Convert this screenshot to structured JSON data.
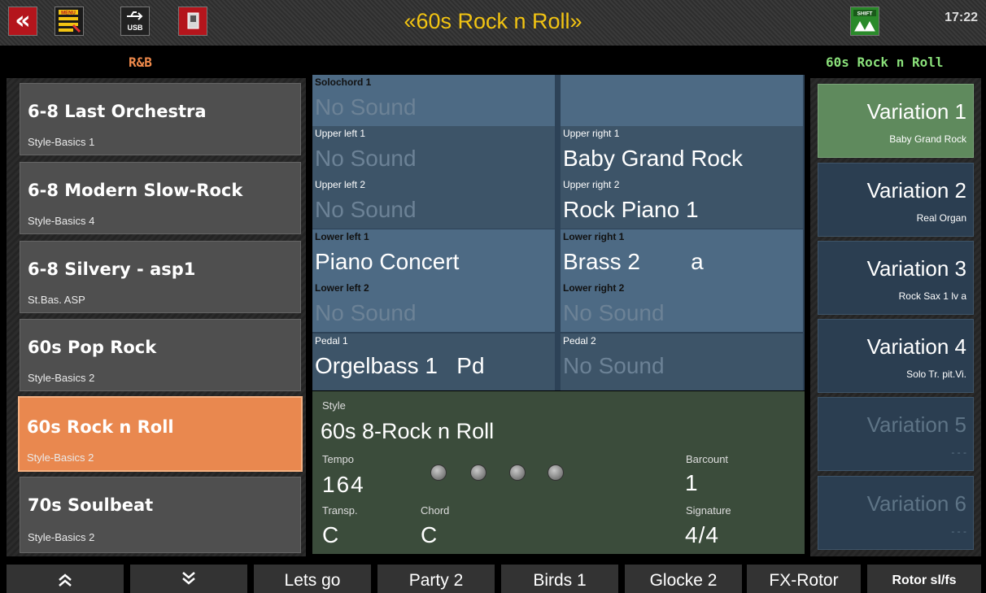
{
  "title": "«60s Rock n Roll»",
  "clock": "17:22",
  "toolbar": {
    "back_icon": "«",
    "menu_label": "MENU",
    "usb_label": "USB",
    "shift_label": "SHIFT"
  },
  "category": "R&B",
  "current_style_header": "60s Rock n Roll",
  "styles": [
    {
      "name": "6-8 Last Orchestra",
      "sub": "Style-Basics 1"
    },
    {
      "name": "6-8 Modern Slow-Rock",
      "sub": "Style-Basics 4"
    },
    {
      "name": "6-8 Silvery - asp1",
      "sub": "St.Bas. ASP"
    },
    {
      "name": "60s Pop Rock",
      "sub": "Style-Basics 2"
    },
    {
      "name": "60s Rock n Roll",
      "sub": "Style-Basics 2"
    },
    {
      "name": "70s Soulbeat",
      "sub": "Style-Basics 2"
    }
  ],
  "sounds": {
    "solochord1": {
      "label": "Solochord 1",
      "value": "No Sound"
    },
    "upper_left1": {
      "label": "Upper left 1",
      "value": "No Sound"
    },
    "upper_right1": {
      "label": "Upper right 1",
      "value": "Baby Grand Rock"
    },
    "upper_left2": {
      "label": "Upper left 2",
      "value": "No Sound"
    },
    "upper_right2": {
      "label": "Upper right 2",
      "value": "Rock Piano 1"
    },
    "lower_left1": {
      "label": "Lower left 1",
      "value": "Piano Concert"
    },
    "lower_right1": {
      "label": "Lower right 1",
      "value": "Brass 2        a"
    },
    "lower_left2": {
      "label": "Lower left 2",
      "value": "No Sound"
    },
    "lower_right2": {
      "label": "Lower right 2",
      "value": "No Sound"
    },
    "pedal1": {
      "label": "Pedal 1",
      "value": "Orgelbass 1   Pd"
    },
    "pedal2": {
      "label": "Pedal 2",
      "value": "No Sound"
    }
  },
  "style_info": {
    "style_label": "Style",
    "style_value": "60s 8-Rock n Roll",
    "tempo_label": "Tempo",
    "tempo_value": "164",
    "barcount_label": "Barcount",
    "barcount_value": "1",
    "transp_label": "Transp.",
    "transp_value": "C",
    "chord_label": "Chord",
    "chord_value": "C",
    "signature_label": "Signature",
    "signature_value": "4/4"
  },
  "variations": [
    {
      "title": "Variation 1",
      "sub": "Baby Grand Rock"
    },
    {
      "title": "Variation 2",
      "sub": "Real Organ"
    },
    {
      "title": "Variation 3",
      "sub": "Rock Sax 1 lv  a"
    },
    {
      "title": "Variation 4",
      "sub": "Solo Tr. pit.Vi."
    },
    {
      "title": "Variation 5",
      "sub": "- - -"
    },
    {
      "title": "Variation 6",
      "sub": "- - -"
    }
  ],
  "bottom": {
    "up": "≈",
    "down": "≈",
    "b1": "Lets go",
    "b2": "Party 2",
    "b3": "Birds 1",
    "b4": "Glocke 2",
    "b5": "FX-Rotor",
    "b6": "Rotor sl/fs"
  }
}
